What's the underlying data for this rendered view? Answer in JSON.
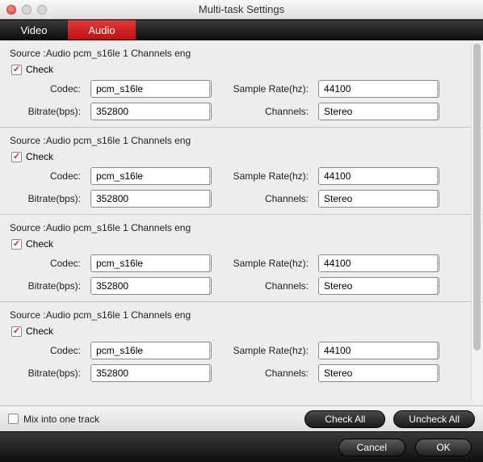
{
  "window": {
    "title": "Multi-task Settings"
  },
  "tabs": {
    "video": "Video",
    "audio": "Audio",
    "active": "audio"
  },
  "blocks": [
    {
      "source": "Source :Audio  pcm_s16le  1 Channels  eng",
      "check_label": "Check",
      "checked": true,
      "codec_label": "Codec:",
      "codec": "pcm_s16le",
      "bitrate_label": "Bitrate(bps):",
      "bitrate": "352800",
      "samplerate_label": "Sample Rate(hz):",
      "samplerate": "44100",
      "channels_label": "Channels:",
      "channels": "Stereo"
    },
    {
      "source": "Source :Audio  pcm_s16le  1 Channels  eng",
      "check_label": "Check",
      "checked": true,
      "codec_label": "Codec:",
      "codec": "pcm_s16le",
      "bitrate_label": "Bitrate(bps):",
      "bitrate": "352800",
      "samplerate_label": "Sample Rate(hz):",
      "samplerate": "44100",
      "channels_label": "Channels:",
      "channels": "Stereo"
    },
    {
      "source": "Source :Audio  pcm_s16le  1 Channels  eng",
      "check_label": "Check",
      "checked": true,
      "codec_label": "Codec:",
      "codec": "pcm_s16le",
      "bitrate_label": "Bitrate(bps):",
      "bitrate": "352800",
      "samplerate_label": "Sample Rate(hz):",
      "samplerate": "44100",
      "channels_label": "Channels:",
      "channels": "Stereo"
    },
    {
      "source": "Source :Audio  pcm_s16le  1 Channels  eng",
      "check_label": "Check",
      "checked": true,
      "codec_label": "Codec:",
      "codec": "pcm_s16le",
      "bitrate_label": "Bitrate(bps):",
      "bitrate": "352800",
      "samplerate_label": "Sample Rate(hz):",
      "samplerate": "44100",
      "channels_label": "Channels:",
      "channels": "Stereo"
    }
  ],
  "footer": {
    "mix_label": "Mix into one track",
    "mix_checked": false,
    "check_all": "Check All",
    "uncheck_all": "Uncheck All",
    "cancel": "Cancel",
    "ok": "OK"
  }
}
